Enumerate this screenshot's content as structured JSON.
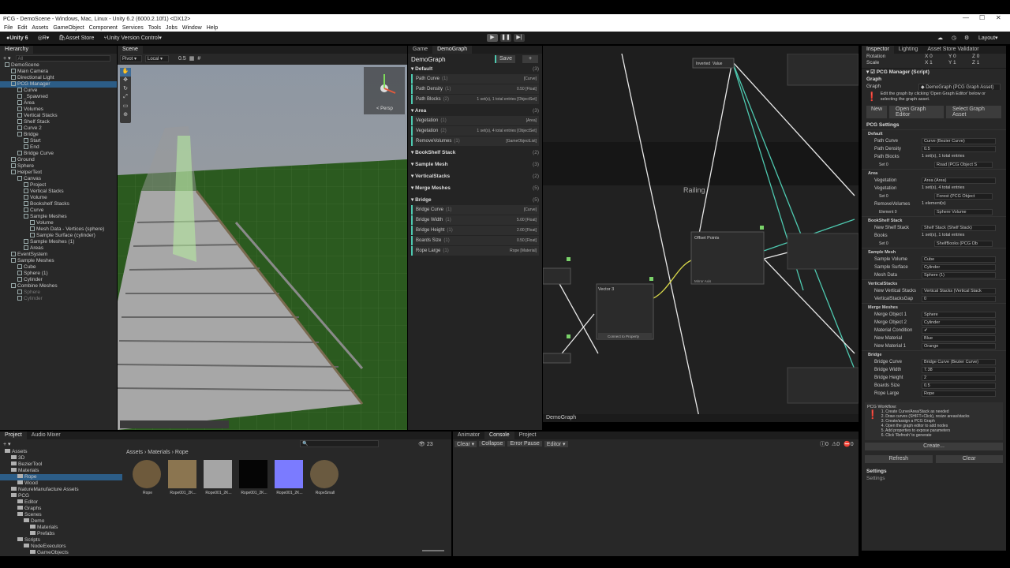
{
  "title": "PCG - DemoScene - Windows, Mac, Linux - Unity 6.2 (6000.2.10f1) <DX12>",
  "menu": [
    "File",
    "Edit",
    "Assets",
    "GameObject",
    "Component",
    "Services",
    "Tools",
    "Jobs",
    "Window",
    "Help"
  ],
  "toolbar": {
    "account": "Unity 6",
    "r": "R",
    "asset_store": "Asset Store",
    "version_control": "Unity Version Control",
    "layout": "Layout"
  },
  "hierarchy": {
    "tab": "Hierarchy",
    "search": "All",
    "items": [
      {
        "t": "DemoScene",
        "d": 0
      },
      {
        "t": "Main Camera",
        "d": 1
      },
      {
        "t": "Directional Light",
        "d": 1
      },
      {
        "t": "PCG Manager",
        "d": 1,
        "sel": true
      },
      {
        "t": "Curve",
        "d": 2
      },
      {
        "t": "_Spawned",
        "d": 2
      },
      {
        "t": "Area",
        "d": 2
      },
      {
        "t": "Volumes",
        "d": 2
      },
      {
        "t": "Vertical Stacks",
        "d": 2
      },
      {
        "t": "Shelf Stack",
        "d": 2
      },
      {
        "t": "Curve 2",
        "d": 2
      },
      {
        "t": "Bridge",
        "d": 2
      },
      {
        "t": "Start",
        "d": 3
      },
      {
        "t": "End",
        "d": 3
      },
      {
        "t": "Bridge Curve",
        "d": 2
      },
      {
        "t": "Ground",
        "d": 1
      },
      {
        "t": "Sphere",
        "d": 1
      },
      {
        "t": "HelperText",
        "d": 1
      },
      {
        "t": "Canvas",
        "d": 2
      },
      {
        "t": "Project",
        "d": 3
      },
      {
        "t": "Vertical Stacks",
        "d": 3
      },
      {
        "t": "Volume",
        "d": 3
      },
      {
        "t": "Bookshelf Stacks",
        "d": 3
      },
      {
        "t": "Curve",
        "d": 3
      },
      {
        "t": "Sample Meshes",
        "d": 3
      },
      {
        "t": "Volume",
        "d": 4
      },
      {
        "t": "Mesh Data - Vertices (sphere)",
        "d": 4
      },
      {
        "t": "Sample Surface (cylinder)",
        "d": 4
      },
      {
        "t": "Sample Meshes (1)",
        "d": 3
      },
      {
        "t": "Areas",
        "d": 3
      },
      {
        "t": "EventSystem",
        "d": 1
      },
      {
        "t": "Sample Meshes",
        "d": 1
      },
      {
        "t": "Cube",
        "d": 2
      },
      {
        "t": "Sphere (1)",
        "d": 2
      },
      {
        "t": "Cylinder",
        "d": 2
      },
      {
        "t": "Combine Meshes",
        "d": 1
      },
      {
        "t": "Sphere",
        "d": 2,
        "dim": true
      },
      {
        "t": "Cylinder",
        "d": 2,
        "dim": true
      }
    ]
  },
  "scene": {
    "tab": "Scene",
    "pivot": "Pivot",
    "local": "Local",
    "snap": "0.5",
    "persp": "< Persp"
  },
  "graph": {
    "tab_game": "Game",
    "tab_demograph": "DemoGraph",
    "name": "DemoGraph",
    "save": "Save",
    "add": "+",
    "footer": "DemoGraph",
    "label": "Railing",
    "sections": [
      {
        "title": "Default",
        "count": "(3)",
        "rows": [
          {
            "n": "Path Curve",
            "i": "(1)",
            "v": "[Curve]"
          },
          {
            "n": "Path Density",
            "i": "(1)",
            "v": "0.50  [Float]"
          },
          {
            "n": "Path Blocks",
            "i": "(2)",
            "v": "1 set(s), 1 total entries  [ObjectSet]"
          }
        ]
      },
      {
        "title": "Area",
        "count": "(3)",
        "rows": [
          {
            "n": "Vegetation",
            "i": "(1)",
            "v": "[Area]"
          },
          {
            "n": "Vegetation",
            "i": "(2)",
            "v": "1 set(s), 4 total entries  [ObjectSet]"
          },
          {
            "n": "RemoveVolumes",
            "i": "(1)",
            "v": "[GameObjectList]"
          }
        ]
      },
      {
        "title": "BookShelf Stack",
        "count": "(2)",
        "rows": []
      },
      {
        "title": "Sample Mesh",
        "count": "(3)",
        "rows": []
      },
      {
        "title": "VerticalStacks",
        "count": "(2)",
        "rows": []
      },
      {
        "title": "Merge Meshes",
        "count": "(5)",
        "rows": []
      },
      {
        "title": "Bridge",
        "count": "(5)",
        "rows": [
          {
            "n": "Bridge Curve",
            "i": "(1)",
            "v": "[Curve]"
          },
          {
            "n": "Bridge Width",
            "i": "(1)",
            "v": "5.00  [Float]"
          },
          {
            "n": "Bridge Height",
            "i": "(1)",
            "v": "2.00  [Float]"
          },
          {
            "n": "Boards Size",
            "i": "(1)",
            "v": "0.50  [Float]"
          },
          {
            "n": "Rope Large",
            "i": "(1)",
            "v": "Rope  [Material]"
          }
        ]
      }
    ],
    "nodes": {
      "offset": "Offset Points",
      "vector3": "Vector 3",
      "inverted": "Inverted",
      "value": "Value",
      "connect": "Connect to Property",
      "mirror": "Mirror Axis"
    }
  },
  "inspector": {
    "tab": "Inspector",
    "lighting": "Lighting",
    "validator": "Asset Store Validator",
    "rotation": "Rotation",
    "scale": "Scale",
    "rot": {
      "x": "0",
      "y": "0",
      "z": "0"
    },
    "scl": {
      "x": "1",
      "y": "1",
      "z": "1"
    },
    "component": "PCG Manager (Script)",
    "graph_h": "Graph",
    "graph_l": "Graph",
    "graph_v": "DemoGraph (PCG Graph Asset)",
    "help": "Edit the graph by clicking 'Open Graph Editor' below or selecting the graph asset.",
    "btn_new": "New",
    "btn_open": "Open Graph Editor",
    "btn_select": "Select Graph Asset",
    "settings_h": "PCG Settings",
    "groups": [
      {
        "h": "Default",
        "rows": [
          {
            "l": "Path Curve",
            "v": "Curve (Bezier Curve)"
          },
          {
            "l": "Path Density",
            "v": "0.5"
          },
          {
            "l": "Path Blocks",
            "v": "1 set(s), 1 total entries"
          },
          {
            "l": "Set 0",
            "v": "Road (PCG Object S"
          }
        ]
      },
      {
        "h": "Area",
        "rows": [
          {
            "l": "Vegetation",
            "v": "Area (Area)"
          },
          {
            "l": "Vegetation",
            "v": "1 set(s), 4 total entries"
          },
          {
            "l": "Set 0",
            "v": "Forest (PCG Object"
          },
          {
            "l": "RemoveVolumes",
            "v": "1 element(s)"
          },
          {
            "l": "Element 0",
            "v": "Sphere Volume"
          }
        ]
      },
      {
        "h": "BookShelf Stack",
        "rows": [
          {
            "l": "New Shelf Stack",
            "v": "Shelf Stack (Shelf Stack)"
          },
          {
            "l": "Books",
            "v": "1 set(s), 1 total entries"
          },
          {
            "l": "Set 0",
            "v": "ShelfBooks (PCG Ob"
          }
        ]
      },
      {
        "h": "Sample Mesh",
        "rows": [
          {
            "l": "Sample Volume",
            "v": "Cube"
          },
          {
            "l": "Sample Surface",
            "v": "Cylinder"
          },
          {
            "l": "Mesh Data",
            "v": "Sphere (1)"
          }
        ]
      },
      {
        "h": "VerticalStacks",
        "rows": [
          {
            "l": "New Vertical Stacks",
            "v": "Vertical Stacks (Vertical Stack"
          },
          {
            "l": "VerticalStacksGap",
            "v": "0"
          }
        ]
      },
      {
        "h": "Merge Meshes",
        "rows": [
          {
            "l": "Merge Object 1",
            "v": "Sphere"
          },
          {
            "l": "Merge Object 2",
            "v": "Cylinder"
          },
          {
            "l": "Material Condition",
            "v": "✔"
          },
          {
            "l": "New Material",
            "v": "Blue"
          },
          {
            "l": "New Material 1",
            "v": "Orange"
          }
        ]
      },
      {
        "h": "Bridge",
        "rows": [
          {
            "l": "Bridge Curve",
            "v": "Bridge Curve (Bezier Curve)"
          },
          {
            "l": "Bridge Width",
            "v": "7.38"
          },
          {
            "l": "Bridge Height",
            "v": "2"
          },
          {
            "l": "Boards Size",
            "v": "0.5"
          },
          {
            "l": "Rope Large",
            "v": "Rope"
          }
        ]
      }
    ],
    "workflow_h": "PCG Workflow:",
    "workflow": [
      "1. Create Curve/Area/Stack as needed",
      "2. Draw curves (SHIFT+Click), resize areas/stacks",
      "3. Create/assign a PCG Graph",
      "4. Open the graph editor to add nodes",
      "5. Add properties to expose parameters",
      "6. Click 'Refresh' to generate"
    ],
    "btn_create": "Create...",
    "btn_refresh": "Refresh",
    "btn_clear": "Clear",
    "settings": "Settings",
    "settings2": "Settings"
  },
  "project": {
    "tab": "Project",
    "audio": "Audio Mixer",
    "breadcrumb": [
      "Assets",
      "Materials",
      "Rope"
    ],
    "tree": [
      {
        "t": "Assets",
        "d": 0
      },
      {
        "t": "3D",
        "d": 1
      },
      {
        "t": "BezierTool",
        "d": 1
      },
      {
        "t": "Materials",
        "d": 1
      },
      {
        "t": "Rope",
        "d": 2,
        "sel": true
      },
      {
        "t": "Wood",
        "d": 2
      },
      {
        "t": "NatureManufacture Assets",
        "d": 1
      },
      {
        "t": "PCG",
        "d": 1
      },
      {
        "t": "Editor",
        "d": 2
      },
      {
        "t": "Graphs",
        "d": 2
      },
      {
        "t": "Scenes",
        "d": 2
      },
      {
        "t": "Demo",
        "d": 3
      },
      {
        "t": "Materials",
        "d": 4
      },
      {
        "t": "Prefabs",
        "d": 4
      },
      {
        "t": "Scripts",
        "d": 2
      },
      {
        "t": "NodeExecutors",
        "d": 3
      },
      {
        "t": "GameObjects",
        "d": 4
      }
    ],
    "assets": [
      {
        "n": "Rope",
        "c": "#6e5a3c"
      },
      {
        "n": "Rope001_2K...",
        "c": "#8b7550"
      },
      {
        "n": "Rope001_2K...",
        "c": "#a5a5a5"
      },
      {
        "n": "Rope001_2K...",
        "c": "#050505"
      },
      {
        "n": "Rope001_2K...",
        "c": "#7b7bff"
      },
      {
        "n": "RopeSmall",
        "c": "#6a5a40"
      }
    ],
    "count": "23"
  },
  "console": {
    "tab_anim": "Animator",
    "tab_console": "Console",
    "tab_project": "Project",
    "clear": "Clear",
    "collapse": "Collapse",
    "error_pause": "Error Pause",
    "editor": "Editor",
    "c1": "0",
    "c2": "0",
    "c3": "0"
  },
  "colors": {
    "accent": "#2c5d87",
    "ground": "#2b5a1f",
    "wire": "#4ec9b0"
  }
}
